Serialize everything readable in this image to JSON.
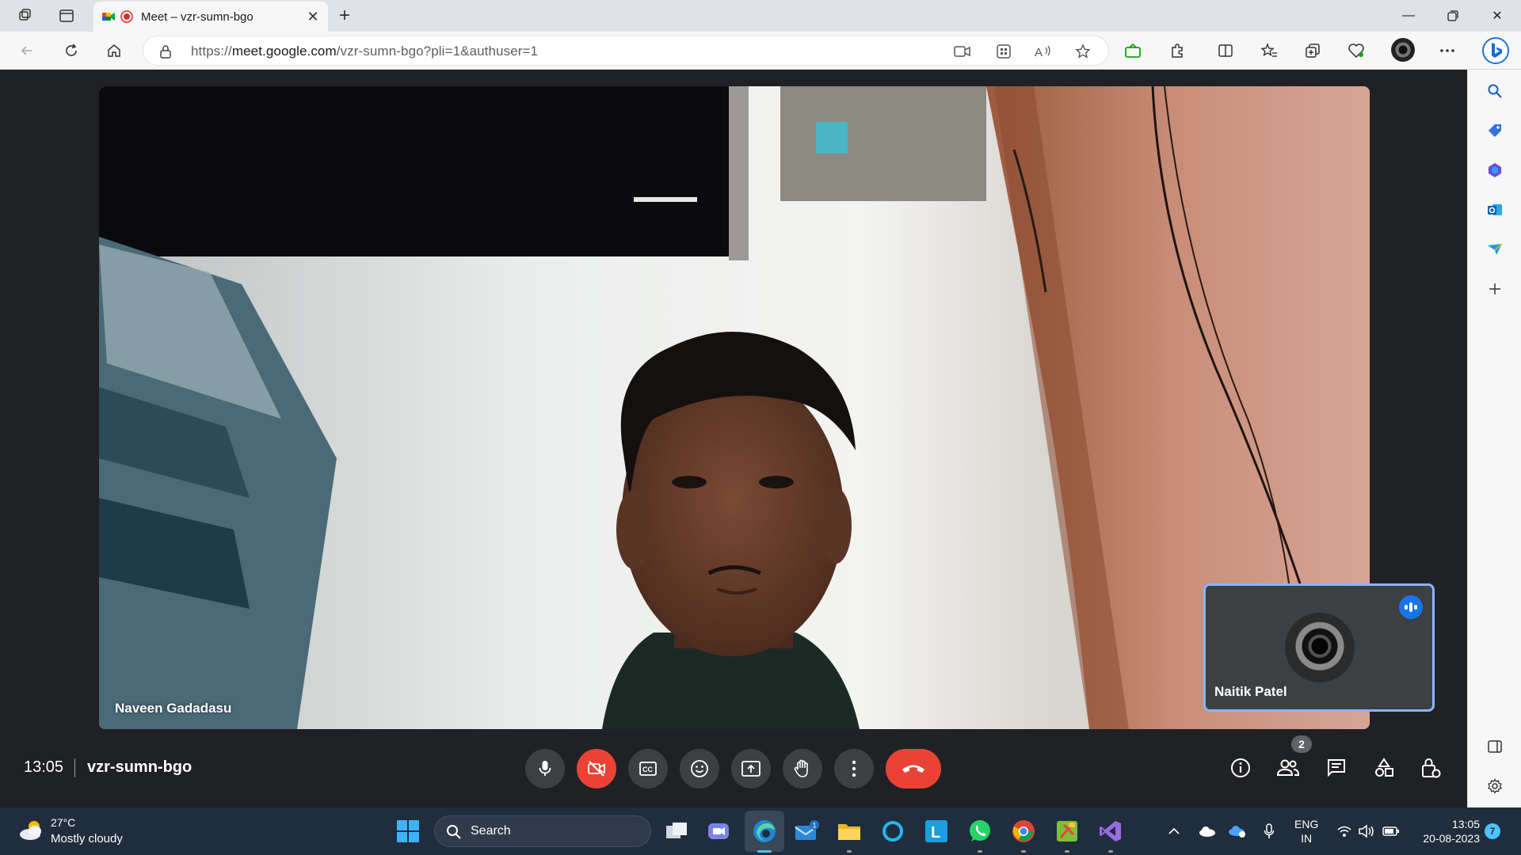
{
  "browser": {
    "tab_title": "Meet – vzr-sumn-bgo",
    "url_prefix": "https://",
    "url_host": "meet.google.com",
    "url_path": "/vzr-sumn-bgo?pli=1&authuser=1"
  },
  "meet": {
    "main_participant": "Naveen Gadadasu",
    "pip_participant": "Naitik Patel",
    "time": "13:05",
    "meeting_code": "vzr-sumn-bgo",
    "participant_count": "2",
    "colors": {
      "hangup": "#ea4335",
      "control_bg": "#3c4043",
      "pip_border": "#8ab4f8",
      "speaking": "#1a73e8"
    }
  },
  "taskbar": {
    "weather_temp": "27°C",
    "weather_desc": "Mostly cloudy",
    "search_label": "Search",
    "lang_line1": "ENG",
    "lang_line2": "IN",
    "time": "13:05",
    "date": "20-08-2023",
    "notification_count": "7",
    "mail_badge": "1"
  },
  "icons": {
    "tab_strip": [
      "workspaces-icon",
      "tab-actions-icon",
      "new-tab-icon"
    ],
    "toolbar": [
      "camera-icon",
      "app-available-icon",
      "read-aloud-icon",
      "favorite-star-icon",
      "extension-green-icon",
      "extensions-icon",
      "split-screen-icon",
      "favorites-icon",
      "collections-icon",
      "browser-essentials-icon",
      "profile-avatar",
      "more-icon",
      "bing-copilot-icon"
    ],
    "sidebar": [
      "search-icon",
      "shopping-tag-icon",
      "m365-icon",
      "outlook-icon",
      "send-icon",
      "add-icon",
      "hide-sidebar-icon",
      "settings-icon"
    ],
    "meet_controls": [
      "mic-icon",
      "camera-off-icon",
      "captions-icon",
      "emoji-icon",
      "present-icon",
      "raise-hand-icon",
      "more-options-icon",
      "hang-up-icon"
    ],
    "meet_right": [
      "info-icon",
      "people-icon",
      "chat-icon",
      "activities-icon",
      "host-controls-icon"
    ]
  }
}
